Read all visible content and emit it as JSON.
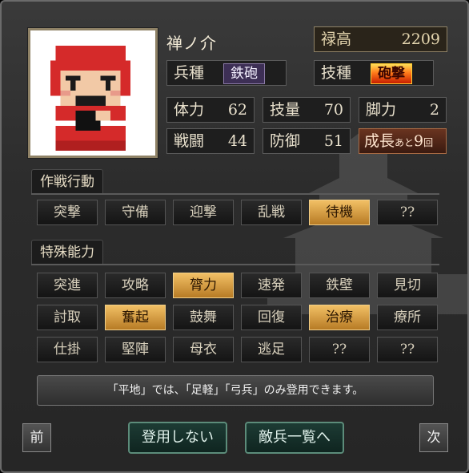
{
  "character": {
    "name": "禅ノ介",
    "rokudaka_label": "禄高",
    "rokudaka_value": "2209",
    "unit_type_label": "兵種",
    "unit_type_value": "鉄砲",
    "skill_type_label": "技種",
    "skill_type_value": "砲撃"
  },
  "stats": {
    "hp_label": "体力",
    "hp_value": "62",
    "skill_label": "技量",
    "skill_value": "70",
    "legs_label": "脚力",
    "legs_value": "2",
    "battle_label": "戦闘",
    "battle_value": "44",
    "defense_label": "防御",
    "defense_value": "51",
    "growth_label": "成長",
    "growth_mid": "あと",
    "growth_value": "9",
    "growth_unit": "回"
  },
  "tactics": {
    "title": "作戦行動",
    "buttons": [
      {
        "label": "突撃",
        "active": false
      },
      {
        "label": "守備",
        "active": false
      },
      {
        "label": "迎撃",
        "active": false
      },
      {
        "label": "乱戦",
        "active": false
      },
      {
        "label": "待機",
        "active": true
      },
      {
        "label": "??",
        "active": false
      }
    ]
  },
  "abilities": {
    "title": "特殊能力",
    "rows": [
      [
        {
          "label": "突進",
          "active": false
        },
        {
          "label": "攻略",
          "active": false
        },
        {
          "label": "膂力",
          "active": true
        },
        {
          "label": "速発",
          "active": false
        },
        {
          "label": "鉄壁",
          "active": false
        },
        {
          "label": "見切",
          "active": false
        }
      ],
      [
        {
          "label": "討取",
          "active": false
        },
        {
          "label": "奮起",
          "active": true
        },
        {
          "label": "鼓舞",
          "active": false
        },
        {
          "label": "回復",
          "active": false
        },
        {
          "label": "治療",
          "active": true
        },
        {
          "label": "療所",
          "active": false
        }
      ],
      [
        {
          "label": "仕掛",
          "active": false
        },
        {
          "label": "堅陣",
          "active": false
        },
        {
          "label": "母衣",
          "active": false
        },
        {
          "label": "逃足",
          "active": false
        },
        {
          "label": "??",
          "active": false
        },
        {
          "label": "??",
          "active": false
        }
      ]
    ]
  },
  "message": "「平地」では、「足軽」「弓兵」のみ登用できます。",
  "footer": {
    "prev_label": "前",
    "dont_hire_label": "登用しない",
    "enemy_list_label": "敵兵一覧へ",
    "next_label": "次"
  }
}
